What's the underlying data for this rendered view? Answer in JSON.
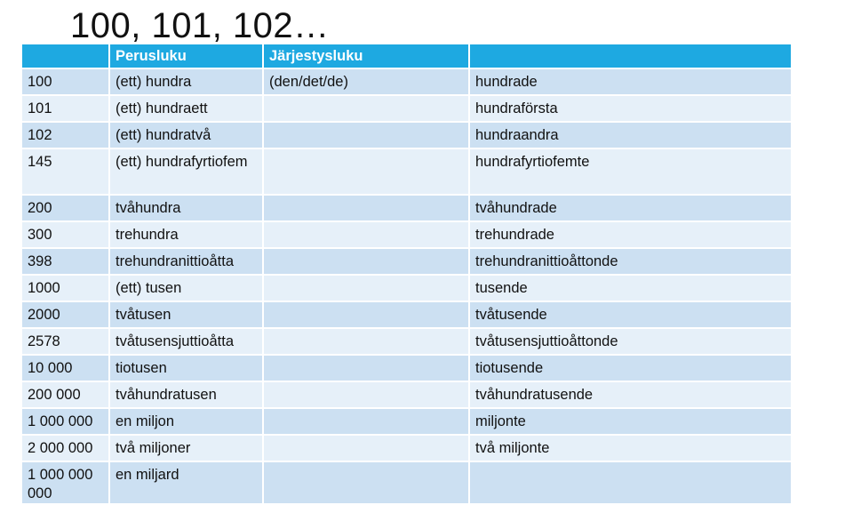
{
  "title": "100, 101, 102…",
  "table": {
    "headers": [
      "",
      "Perusluku",
      "Järjestysluku",
      ""
    ],
    "rows": [
      {
        "number": "100",
        "cardinal": "(ett) hundra",
        "article": "(den/det/de)",
        "ordinal": "hundrade"
      },
      {
        "number": "101",
        "cardinal": "(ett) hundraett",
        "article": "",
        "ordinal": "hundraförsta"
      },
      {
        "number": "102",
        "cardinal": "(ett) hundratvå",
        "article": "",
        "ordinal": "hundraandra"
      },
      {
        "number": "145",
        "cardinal": "(ett) hundrafyrtiofem",
        "article": "",
        "ordinal": "hundrafyrtiofemte"
      },
      {
        "number": "200",
        "cardinal": "tvåhundra",
        "article": "",
        "ordinal": "tvåhundrade"
      },
      {
        "number": "300",
        "cardinal": "trehundra",
        "article": "",
        "ordinal": "trehundrade"
      },
      {
        "number": "398",
        "cardinal": "trehundranittioåtta",
        "article": "",
        "ordinal": "trehundranittioåttonde"
      },
      {
        "number": "1000",
        "cardinal": "(ett) tusen",
        "article": "",
        "ordinal": "tusende"
      },
      {
        "number": "2000",
        "cardinal": "tvåtusen",
        "article": "",
        "ordinal": "tvåtusende"
      },
      {
        "number": "2578",
        "cardinal": "tvåtusensjuttioåtta",
        "article": "",
        "ordinal": "tvåtusensjuttioåttonde"
      },
      {
        "number": "10 000",
        "cardinal": "tiotusen",
        "article": "",
        "ordinal": "tiotusende"
      },
      {
        "number": "200 000",
        "cardinal": "tvåhundratusen",
        "article": "",
        "ordinal": "tvåhundratusende"
      },
      {
        "number": "1 000 000",
        "cardinal": "en miljon",
        "article": "",
        "ordinal": "miljonte"
      },
      {
        "number": "2 000 000",
        "cardinal": "två miljoner",
        "article": "",
        "ordinal": "två miljonte"
      },
      {
        "number": "1 000 000 000",
        "cardinal": "en miljard",
        "article": "",
        "ordinal": ""
      }
    ]
  },
  "colors": {
    "header": "#1ea9e1",
    "row_dark": "#cce0f2",
    "row_light": "#e6f0f9"
  }
}
